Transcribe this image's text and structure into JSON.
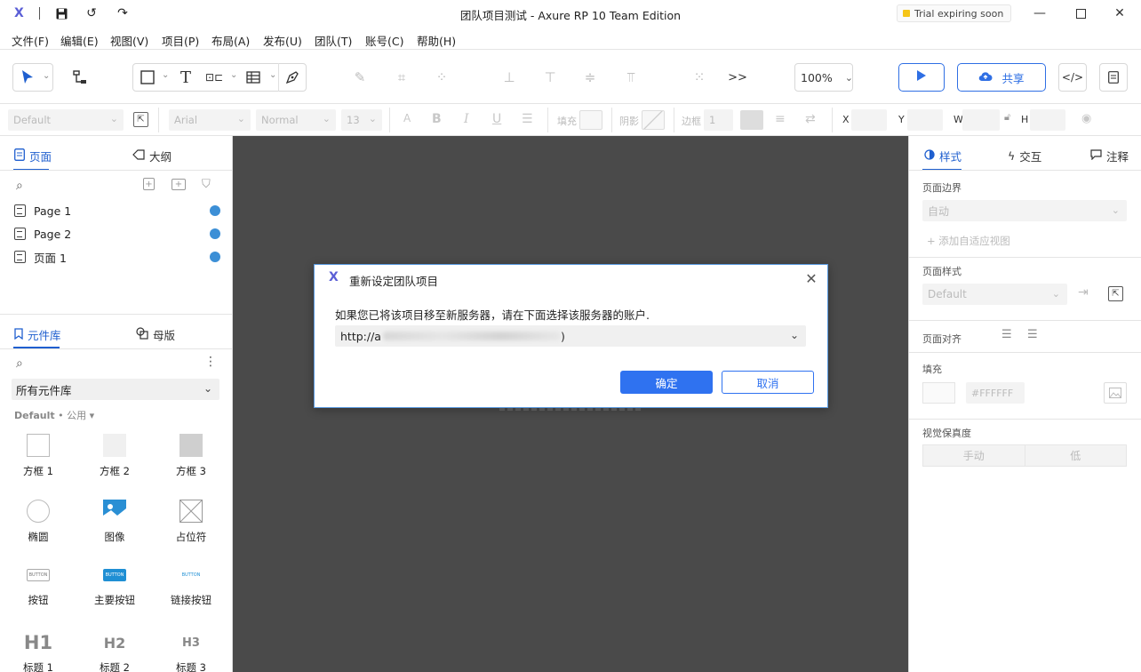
{
  "titlebar": {
    "logo": "X",
    "title": "团队项目测试 - Axure RP 10 Team Edition",
    "trial": "Trial expiring soon"
  },
  "menu": [
    "文件(F)",
    "编辑(E)",
    "视图(V)",
    "项目(P)",
    "布局(A)",
    "发布(U)",
    "团队(T)",
    "账号(C)",
    "帮助(H)"
  ],
  "toolbar": {
    "zoom": "100%",
    "share_label": "共享",
    "more_label": ">>"
  },
  "formatbar": {
    "style": "Default",
    "font": "Arial",
    "weight": "Normal",
    "size": "13",
    "fill_label": "填充",
    "shadow_label": "阴影",
    "border_label": "边框",
    "border_value": "1",
    "x_label": "X",
    "y_label": "Y",
    "w_label": "W",
    "h_label": "H"
  },
  "leftpanel": {
    "tab_pages": "页面",
    "tab_outline": "大纲",
    "pages": [
      "Page 1",
      "Page 2",
      "页面 1"
    ],
    "tab_library": "元件库",
    "tab_masters": "母版",
    "library_select": "所有元件库",
    "library_group": "Default",
    "library_group_sub": "• 公用 ▾",
    "widgets": [
      {
        "label": "方框 1"
      },
      {
        "label": "方框 2"
      },
      {
        "label": "方框 3"
      },
      {
        "label": "椭圆"
      },
      {
        "label": "图像"
      },
      {
        "label": "占位符"
      },
      {
        "label": "按钮"
      },
      {
        "label": "主要按钮"
      },
      {
        "label": "链接按钮"
      },
      {
        "label": "标题 1"
      },
      {
        "label": "标题 2"
      },
      {
        "label": "标题 3"
      }
    ],
    "button_text": "BUTTON",
    "h1": "H1",
    "h2": "H2",
    "h3": "H3"
  },
  "rightpanel": {
    "tab_style": "样式",
    "tab_interact": "交互",
    "tab_notes": "注释",
    "page_bounds_label": "页面边界",
    "page_bounds_value": "自动",
    "add_adaptive": "+ 添加自适应视图",
    "page_style_label": "页面样式",
    "page_style_value": "Default",
    "page_align_label": "页面对齐",
    "fill_label": "填充",
    "fill_value": "#FFFFFF",
    "fidelity_label": "视觉保真度",
    "fidelity_sketch": "手动",
    "fidelity_low": "低"
  },
  "modal": {
    "logo": "X",
    "title": "重新设定团队项目",
    "message": "如果您已将该项目移至新服务器，请在下面选择该服务器的账户.",
    "select_prefix": "http://a",
    "select_suffix": ")",
    "ok": "确定",
    "cancel": "取消"
  },
  "colors": {
    "accent": "#2f72f0",
    "canvas": "#4a4a4a",
    "page_dot": "#3c8fd6",
    "logo": "#5b5fd6"
  }
}
